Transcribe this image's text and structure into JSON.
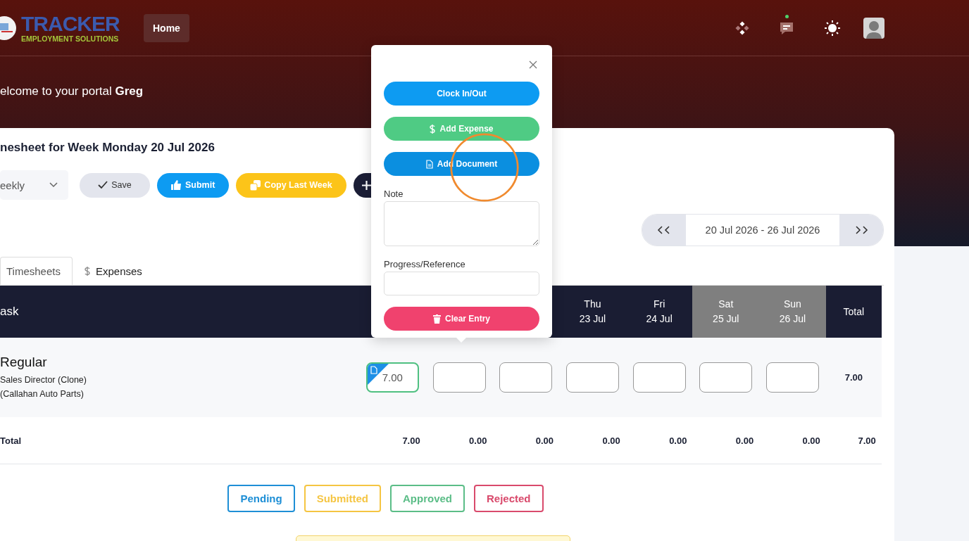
{
  "nav": {
    "logo": {
      "title": "TRACKER",
      "subtitle": "EMPLOYMENT SOLUTIONS"
    },
    "items": [
      {
        "label": "Home",
        "selected": true
      }
    ],
    "messages": {
      "unread": true
    }
  },
  "welcome": "elcome to your portal **Greg**",
  "timesheet": {
    "title": "nesheet for Week Monday 20 Jul 2026",
    "period": "eekly",
    "actions": [
      {
        "kind": "save",
        "label": "Save"
      },
      {
        "kind": "submit",
        "label": "Submit"
      },
      {
        "kind": "copy",
        "label": "Copy Last Week"
      },
      {
        "kind": "add"
      }
    ],
    "date_range": "20 Jul 2026 - 26 Jul 2026",
    "tabs": [
      {
        "label": "Timesheets",
        "selected": true
      },
      {
        "label": "Expenses",
        "selected": false
      }
    ],
    "table": {
      "task_heading": "ask",
      "total_heading": "Total",
      "days": [
        {
          "day": "Thu",
          "date": "23 Jul",
          "weekend": false
        },
        {
          "day": "Fri",
          "date": "24 Jul",
          "weekend": false
        },
        {
          "day": "Sat",
          "date": "25 Jul",
          "weekend": true
        },
        {
          "day": "Sun",
          "date": "26 Jul",
          "weekend": true
        }
      ],
      "rows": [
        {
          "name": "Regular",
          "role": "Sales Director (Clone)",
          "client": "(Callahan Auto Parts)",
          "total": "7.00",
          "hours": [
            {
              "value": "7.00",
              "has_document": true,
              "selected": true
            },
            {
              "has_document": false,
              "selected": false
            },
            {
              "has_document": false,
              "selected": false
            },
            {
              "has_document": false,
              "selected": false
            },
            {
              "has_document": false,
              "selected": false
            },
            {
              "has_document": false,
              "selected": false
            },
            {
              "has_document": false,
              "selected": false
            }
          ]
        }
      ],
      "totals": {
        "label": "Total",
        "values": [
          "7.00",
          "0.00",
          "0.00",
          "0.00",
          "0.00",
          "0.00",
          "0.00"
        ],
        "total": "7.00"
      }
    },
    "legend": [
      {
        "label": "Pending",
        "color": "#1e8fd6"
      },
      {
        "label": "Submitted",
        "color": "#f5c542"
      },
      {
        "label": "Approved",
        "color": "#5bbd87"
      },
      {
        "label": "Rejected",
        "color": "#d94a6c"
      }
    ]
  },
  "popup": {
    "buttons": [
      {
        "kind": "clock",
        "label": "Clock In/Out"
      },
      {
        "kind": "expense",
        "label": "Add Expense"
      },
      {
        "kind": "document",
        "label": "Add Document"
      }
    ],
    "note_label": "Note",
    "reference_label": "Progress/Reference",
    "clear_label": "Clear Entry"
  }
}
